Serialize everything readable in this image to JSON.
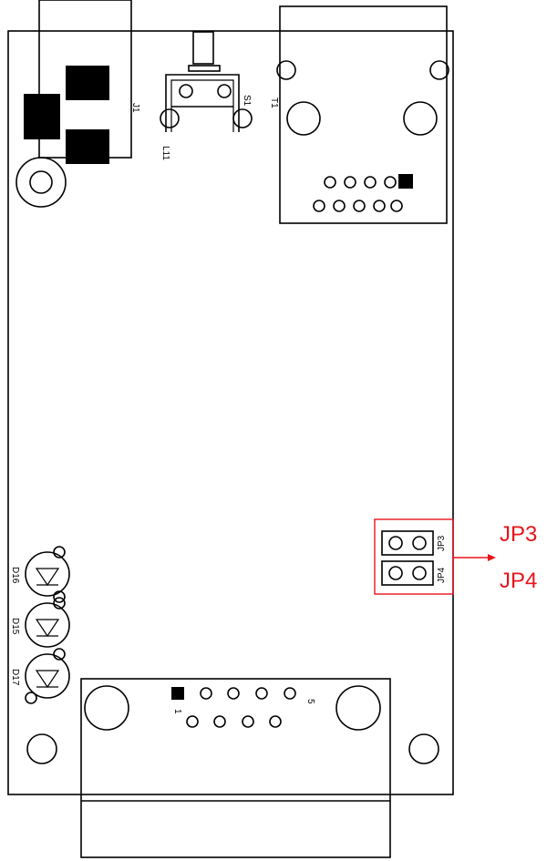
{
  "board": {
    "labels": {
      "j1": "J1",
      "s1": "S1",
      "l11": "L11",
      "t1": "T1",
      "jp3": "JP3",
      "jp4": "JP4",
      "d16": "D16",
      "d15": "D15",
      "d17": "D17",
      "pin1": "1",
      "pin5": "5"
    }
  },
  "callouts": {
    "jp3": "JP3",
    "jp4": "JP4"
  },
  "colors": {
    "outline": "#000000",
    "highlight": "#e8141b"
  }
}
